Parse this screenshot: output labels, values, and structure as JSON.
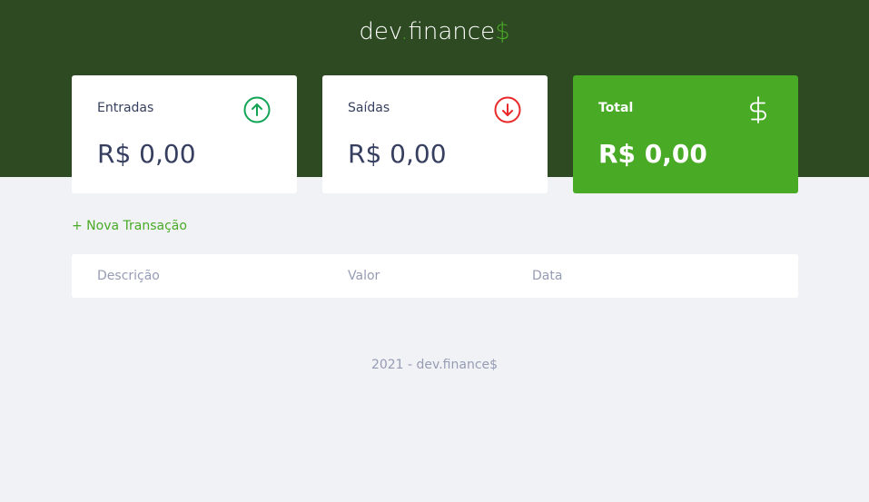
{
  "header": {
    "logo_part1": "dev",
    "logo_dot": ".",
    "logo_part2": "finance",
    "logo_symbol": "$"
  },
  "cards": [
    {
      "title": "Entradas",
      "value": "R$ 0,00",
      "icon": "arrow-up-circle-icon",
      "icon_color": "#12a454"
    },
    {
      "title": "Saídas",
      "value": "R$ 0,00",
      "icon": "arrow-down-circle-icon",
      "icon_color": "#e92929"
    },
    {
      "title": "Total",
      "value": "R$ 0,00",
      "icon": "dollar-sign-icon",
      "icon_color": "#ffffff"
    }
  ],
  "actions": {
    "new_transaction": "+ Nova Transação"
  },
  "table": {
    "headers": [
      "Descrição",
      "Valor",
      "Data"
    ]
  },
  "footer": {
    "text": "2021 - dev.finance$"
  },
  "colors": {
    "header_bg": "#2d4a22",
    "accent": "#49aa26",
    "background": "#f0f2f5",
    "text": "#363f5f",
    "muted": "#969cb3"
  }
}
